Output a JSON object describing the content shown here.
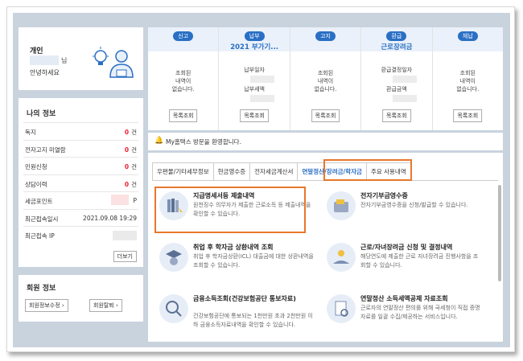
{
  "profile": {
    "label": "개인",
    "nim": "님",
    "hello": "안녕하세요"
  },
  "myinfo": {
    "title": "나의 정보",
    "rows": [
      {
        "label": "독지",
        "count": "0",
        "unit": "건"
      },
      {
        "label": "전자고지 미열람",
        "count": "0",
        "unit": "건"
      },
      {
        "label": "민원신청",
        "count": "0",
        "unit": "건"
      },
      {
        "label": "상담이력",
        "count": "0",
        "unit": "건"
      },
      {
        "label": "세금포인트",
        "count": "",
        "unit": "P"
      },
      {
        "label": "최근접속일시",
        "value": "2021.09.08 19:29"
      },
      {
        "label": "최근접속 IP",
        "value": ""
      }
    ],
    "more": "더보기"
  },
  "member": {
    "title": "회원 정보",
    "edit": "회원정보수정 ›",
    "leave": "회원탈퇴 ›"
  },
  "topbar": [
    {
      "badge": "신고",
      "sub": "",
      "lines": [
        "조회된",
        "내역이",
        "없습니다."
      ],
      "btn": "목록조회"
    },
    {
      "badge": "납부",
      "sub": "2021 부가기...",
      "lines": [
        "납부일자",
        "",
        "납부세액"
      ],
      "btn": "목록조회"
    },
    {
      "badge": "고지",
      "sub": "",
      "lines": [
        "조회된",
        "내역이",
        "없습니다."
      ],
      "btn": "목록조회"
    },
    {
      "badge": "환급",
      "sub": "근로장려금",
      "lines": [
        "환급결정일자",
        "",
        "환급금액"
      ],
      "btn": "목록조회"
    },
    {
      "badge": "체납",
      "sub": "",
      "lines": [
        "조회된",
        "내역이",
        "없습니다."
      ],
      "btn": "목록조회"
    }
  ],
  "welcome": "My홈택스 방문을 환영합니다.",
  "tabs": [
    "우편물/기타세무정보",
    "현금영수증",
    "전자세금계산서",
    "연말정산/장려금/학자금",
    "주요 사용내역"
  ],
  "items": [
    {
      "title": "지급명세서등 제출내역",
      "desc": "원천징수 의무자가 제출한 근로소득 등 제출내역을 확인할 수 있습니다.",
      "icon": "books-icon"
    },
    {
      "title": "전자기부금영수증",
      "desc": "전자기부금영수증을 신청/발급할 수 있습니다.",
      "icon": "wallet-icon"
    },
    {
      "title": "취업 후 학자금 상환내역 조회",
      "desc": "취업 후 학자금상환(ICL) 대출금에 대한 상환내역을 조회할 수 있습니다.",
      "icon": "graduate-icon"
    },
    {
      "title": "근로/자녀장려금 신청 및 결정내역",
      "desc": "해당연도에 제출한 근로 자녀장려금 진행사항을 조회할 수 있습니다.",
      "icon": "hands-icon"
    },
    {
      "title": "금융소득조회(건강보험공단 통보자료)",
      "desc": "건강보험공단에 통보되는 1천만원 초과 2천만원 이하 금융소득자료내역을 확인할 수 있습니다.",
      "icon": "search-money-icon"
    },
    {
      "title": "연말정산 소득세액공제 자료조회",
      "desc": "근로자의 연말정산 편의를 위해 국세청이 직접 증명자료를 일괄 수집/제공하는 서비스입니다.",
      "icon": "document-search-icon"
    }
  ]
}
